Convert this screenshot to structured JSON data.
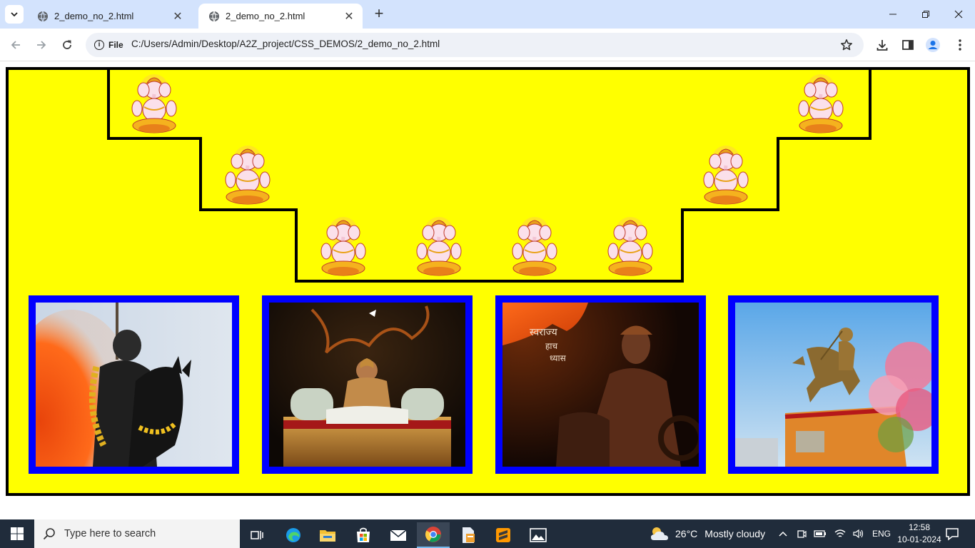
{
  "browser": {
    "tabs": [
      {
        "title": "2_demo_no_2.html",
        "active": false
      },
      {
        "title": "2_demo_no_2.html",
        "active": true
      }
    ],
    "new_tab_label": "+",
    "security_chip": "File",
    "url": "C:/Users/Admin/Desktop/A2Z_project/CSS_DEMOS/2_demo_no_2.html"
  },
  "page": {
    "stage_color": "#ffff00",
    "frame_color": "#000000",
    "photo_border_color": "#0000ff",
    "ganesh_images": [
      {
        "id": "ganesh-1",
        "row": "top-left"
      },
      {
        "id": "ganesh-2",
        "row": "middle-left"
      },
      {
        "id": "ganesh-3",
        "row": "bottom"
      },
      {
        "id": "ganesh-4",
        "row": "bottom"
      },
      {
        "id": "ganesh-5",
        "row": "bottom"
      },
      {
        "id": "ganesh-6",
        "row": "bottom"
      },
      {
        "id": "ganesh-7",
        "row": "middle-right"
      },
      {
        "id": "ganesh-8",
        "row": "top-right"
      }
    ],
    "photos": [
      {
        "id": "photo-statue-horse-flag"
      },
      {
        "id": "photo-throne"
      },
      {
        "id": "photo-swarajya",
        "caption_lines": [
          "स्वराज्य",
          "हाच",
          "ध्यास"
        ]
      },
      {
        "id": "photo-equestrian-statue"
      }
    ]
  },
  "taskbar": {
    "search_placeholder": "Type here to search",
    "weather_temp": "26°C",
    "weather_text": "Mostly cloudy",
    "language": "ENG",
    "time": "12:58",
    "date": "10-01-2024"
  }
}
